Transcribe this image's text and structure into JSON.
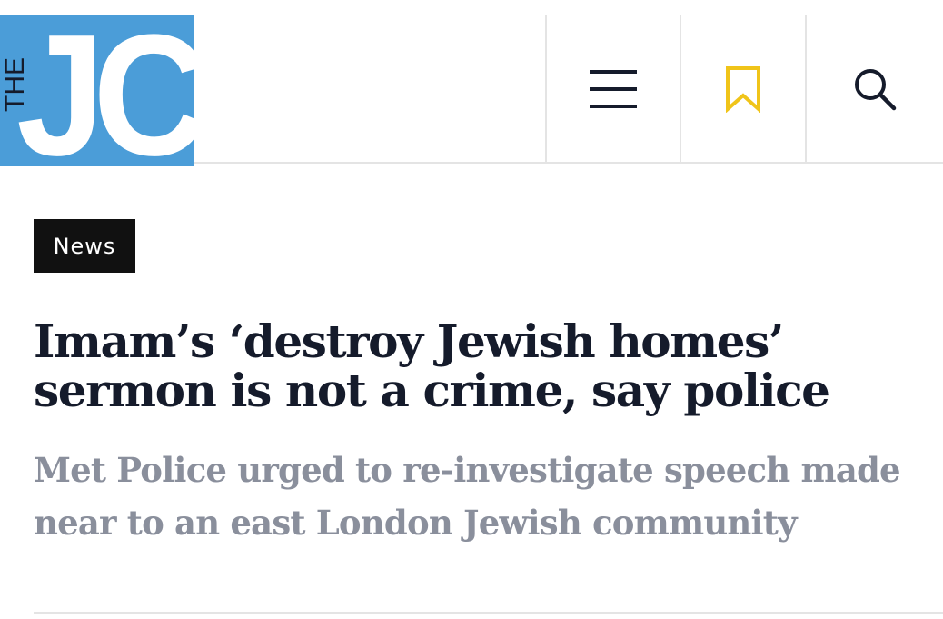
{
  "brand": {
    "logo_small": "THE",
    "logo_large": "JC",
    "logo_color": "#4b9dd8"
  },
  "header": {
    "icons": [
      "menu-icon",
      "bookmark-icon",
      "search-icon"
    ],
    "bookmark_color": "#f0c419",
    "icon_color": "#151b2b"
  },
  "article": {
    "category": "News",
    "headline": "Imam’s ‘destroy Jewish homes’ sermon is not a crime, say police",
    "subheadline": "Met Police urged to re-investigate speech made near to an east London Jewish community"
  }
}
